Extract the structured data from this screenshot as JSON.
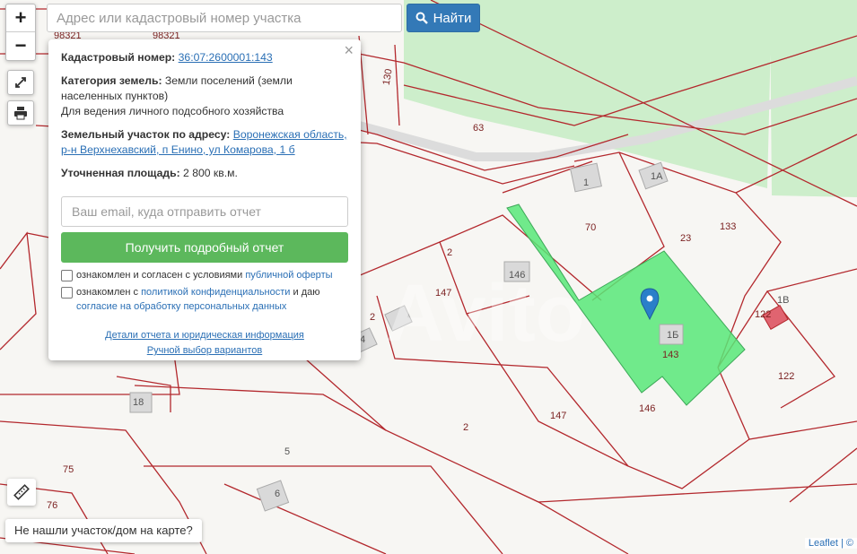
{
  "search": {
    "placeholder": "Адрес или кадастровый номер участка",
    "button_label": "Найти"
  },
  "controls": {
    "zoom_in": "+",
    "zoom_out": "−"
  },
  "popup": {
    "cadastral_label": "Кадастровый номер:",
    "cadastral_value": "36:07:2600001:143",
    "category_label": "Категория земель:",
    "category_value": "Земли поселений (земли населенных пунктов)",
    "usage": "Для ведения личного подсобного хозяйства",
    "address_label": "Земельный участок по адресу:",
    "address_line1": "Воронежская область,",
    "address_line2": "р-н Верхнехавский, п Енино, ул Комарова, 1 б",
    "area_label": "Уточненная площадь:",
    "area_value": "2 800 кв.м.",
    "email_placeholder": "Ваш email, куда отправить отчет",
    "report_button": "Получить подробный отчет",
    "consent1_text": "ознакомлен и согласен с условиями",
    "consent1_link": "публичной оферты",
    "consent2_text1": "ознакомлен с",
    "consent2_link1": "политикой конфиденциальности",
    "consent2_text2": "и даю",
    "consent2_link2": "согласие на обработку персональных данных",
    "link_details": "Детали отчета и юридическая информация",
    "link_manual": "Ручной выбор вариантов",
    "close": "×"
  },
  "not_found_button": "Не нашли участок/дом на карте?",
  "attribution": "Leaflet | ©",
  "map_labels": {
    "l130": "130",
    "l63": "63",
    "l1": "1",
    "l1a": "1А",
    "l70": "70",
    "l23": "23",
    "l133": "133",
    "l2a": "2",
    "l147a": "147",
    "l146a": "146",
    "l2b": "2",
    "l4": "4",
    "l143": "143",
    "l1b": "1Б",
    "l1v": "1В",
    "l122a": "122",
    "l122b": "122",
    "l18": "18",
    "l146b": "146",
    "l147b": "147",
    "l2c": "2",
    "l5": "5",
    "l6": "6",
    "l75": "75",
    "l76": "76",
    "top1": "98321",
    "top2": "98321"
  },
  "colors": {
    "selected_parcel": "#58e878",
    "forest": "#cfedc8",
    "boundary": "#b3282d",
    "button_blue": "#3379b7",
    "button_green": "#5cb85c",
    "marker": "#2a7fc9"
  }
}
